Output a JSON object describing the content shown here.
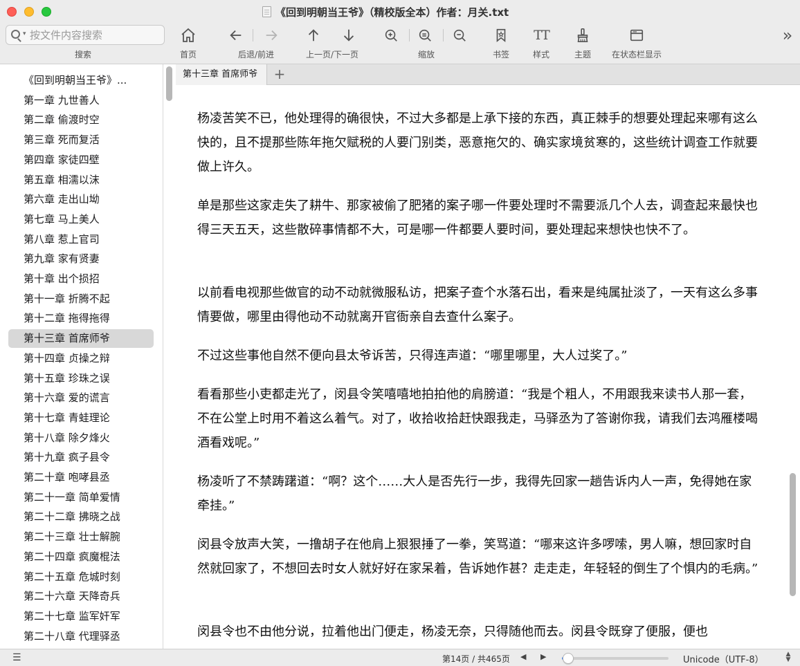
{
  "window": {
    "title": "《回到明朝当王爷》（精校版全本）作者：月关.txt"
  },
  "search": {
    "placeholder": "按文件内容搜索",
    "label": "搜索"
  },
  "toolbar": {
    "home_label": "首页",
    "back_forward_label": "后退/前进",
    "prev_next_page_label": "上一页/下一页",
    "zoom_label": "缩放",
    "bookmark_label": "书签",
    "style_label": "样式",
    "theme_label": "主题",
    "statusbar_label": "在状态栏显示",
    "style_icon_text": "TT",
    "more_icon_text": "»"
  },
  "sidebar": {
    "selected_index": 13,
    "items": [
      "《回到明朝当王爷》...",
      "第一章 九世善人",
      "第二章 偷渡时空",
      "第三章 死而复活",
      "第四章 家徒四壁",
      "第五章 相濡以沫",
      "第六章 走出山坳",
      "第七章 马上美人",
      "第八章 惹上官司",
      "第九章 家有贤妻",
      "第十章 出个损招",
      "第十一章 折腾不起",
      "第十二章 拖得拖得",
      "第十三章 首席师爷",
      "第十四章 贞操之辩",
      "第十五章 珍珠之误",
      "第十六章 爱的谎言",
      "第十七章 青蛙理论",
      "第十八章 除夕烽火",
      "第十九章 疯子县令",
      "第二十章 咆哮县丞",
      "第二十一章 简单爱情",
      "第二十二章 拂晓之战",
      "第二十三章 壮士解腕",
      "第二十四章 疯魔棍法",
      "第二十五章 危城时刻",
      "第二十六章 天降奇兵",
      "第二十七章 监军奸军",
      "第二十八章 代理驿丞"
    ]
  },
  "tabs": [
    {
      "label": "第十三章 首席师爷"
    }
  ],
  "content": {
    "paragraphs": [
      "杨凌苦笑不已，他处理得的确很快，不过大多都是上承下接的东西，真正棘手的想要处理起来哪有这么快的，且不提那些陈年拖欠赋税的人要门别类，恶意拖欠的、确实家境贫寒的，这些统计调查工作就要做上许久。",
      "单是那些这家走失了耕牛、那家被偷了肥猪的案子哪一件要处理时不需要派几个人去，调查起来最快也得三天五天，这些散碎事情都不大，可是哪一件都要人要时间，要处理起来想快也快不了。",
      "以前看电视那些做官的动不动就微服私访，把案子查个水落石出，看来是纯属扯淡了，一天有这么多事情要做，哪里由得他动不动就离开官衙亲自去查什么案子。",
      "不过这些事他自然不便向县太爷诉苦，只得连声道：“哪里哪里，大人过奖了。”",
      "看看那些小吏都走光了，闵县令笑嘻嘻地拍拍他的肩膀道：“我是个粗人，不用跟我来读书人那一套，不在公堂上时用不着这么着气。对了，收拾收拾赶快跟我走，马驿丞为了答谢你我，请我们去鸿雁楼喝酒看戏呢。”",
      "杨凌听了不禁踌躇道：“啊？这个……大人是否先行一步，我得先回家一趟告诉内人一声，免得她在家牵挂。”",
      "闵县令放声大笑，一撸胡子在他肩上狠狠捶了一拳，笑骂道：“哪来这许多啰嗦，男人嘛，想回家时自然就回家了，不想回去时女人就好好在家呆着，告诉她作甚？走走走，年轻轻的倒生了个惧内的毛病。”",
      "闵县令也不由他分说，拉着他出门便走，杨凌无奈，只得随他而去。闵县令既穿了便服，便也"
    ]
  },
  "statusbar": {
    "page_info": "第14页 / 共465页",
    "prev_icon_text": "◀",
    "next_icon_text": "▶",
    "toggle_icon_text": "☰",
    "progress_fraction": 0.03,
    "encoding": "Unicode（UTF-8）",
    "accent_color": "#3b82f6"
  }
}
